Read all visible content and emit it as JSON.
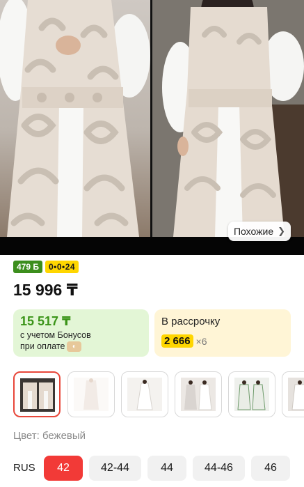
{
  "gallery": {
    "similar_label": "Похожие",
    "similar_icon": "chevron-right-icon"
  },
  "badges": {
    "points": "479 Б",
    "installment_tag": "0•0•24"
  },
  "price": "15 996 ₸",
  "bonus_card": {
    "price": "15 517 ₸",
    "line1": "с учетом Бонусов",
    "line2": "при оплате"
  },
  "installment_card": {
    "title": "В рассрочку",
    "amount": "2 666",
    "multiplier": "×6"
  },
  "color": "Цвет: бежевый",
  "sizes": {
    "system": "RUS",
    "options": [
      "42",
      "42-44",
      "44",
      "44-46",
      "46"
    ],
    "selected": "42"
  },
  "colors": {
    "accent_red": "#f23a37",
    "bonus_green": "#3a9418",
    "badge_green": "#3c8e1d",
    "badge_yellow": "#ffd600"
  }
}
